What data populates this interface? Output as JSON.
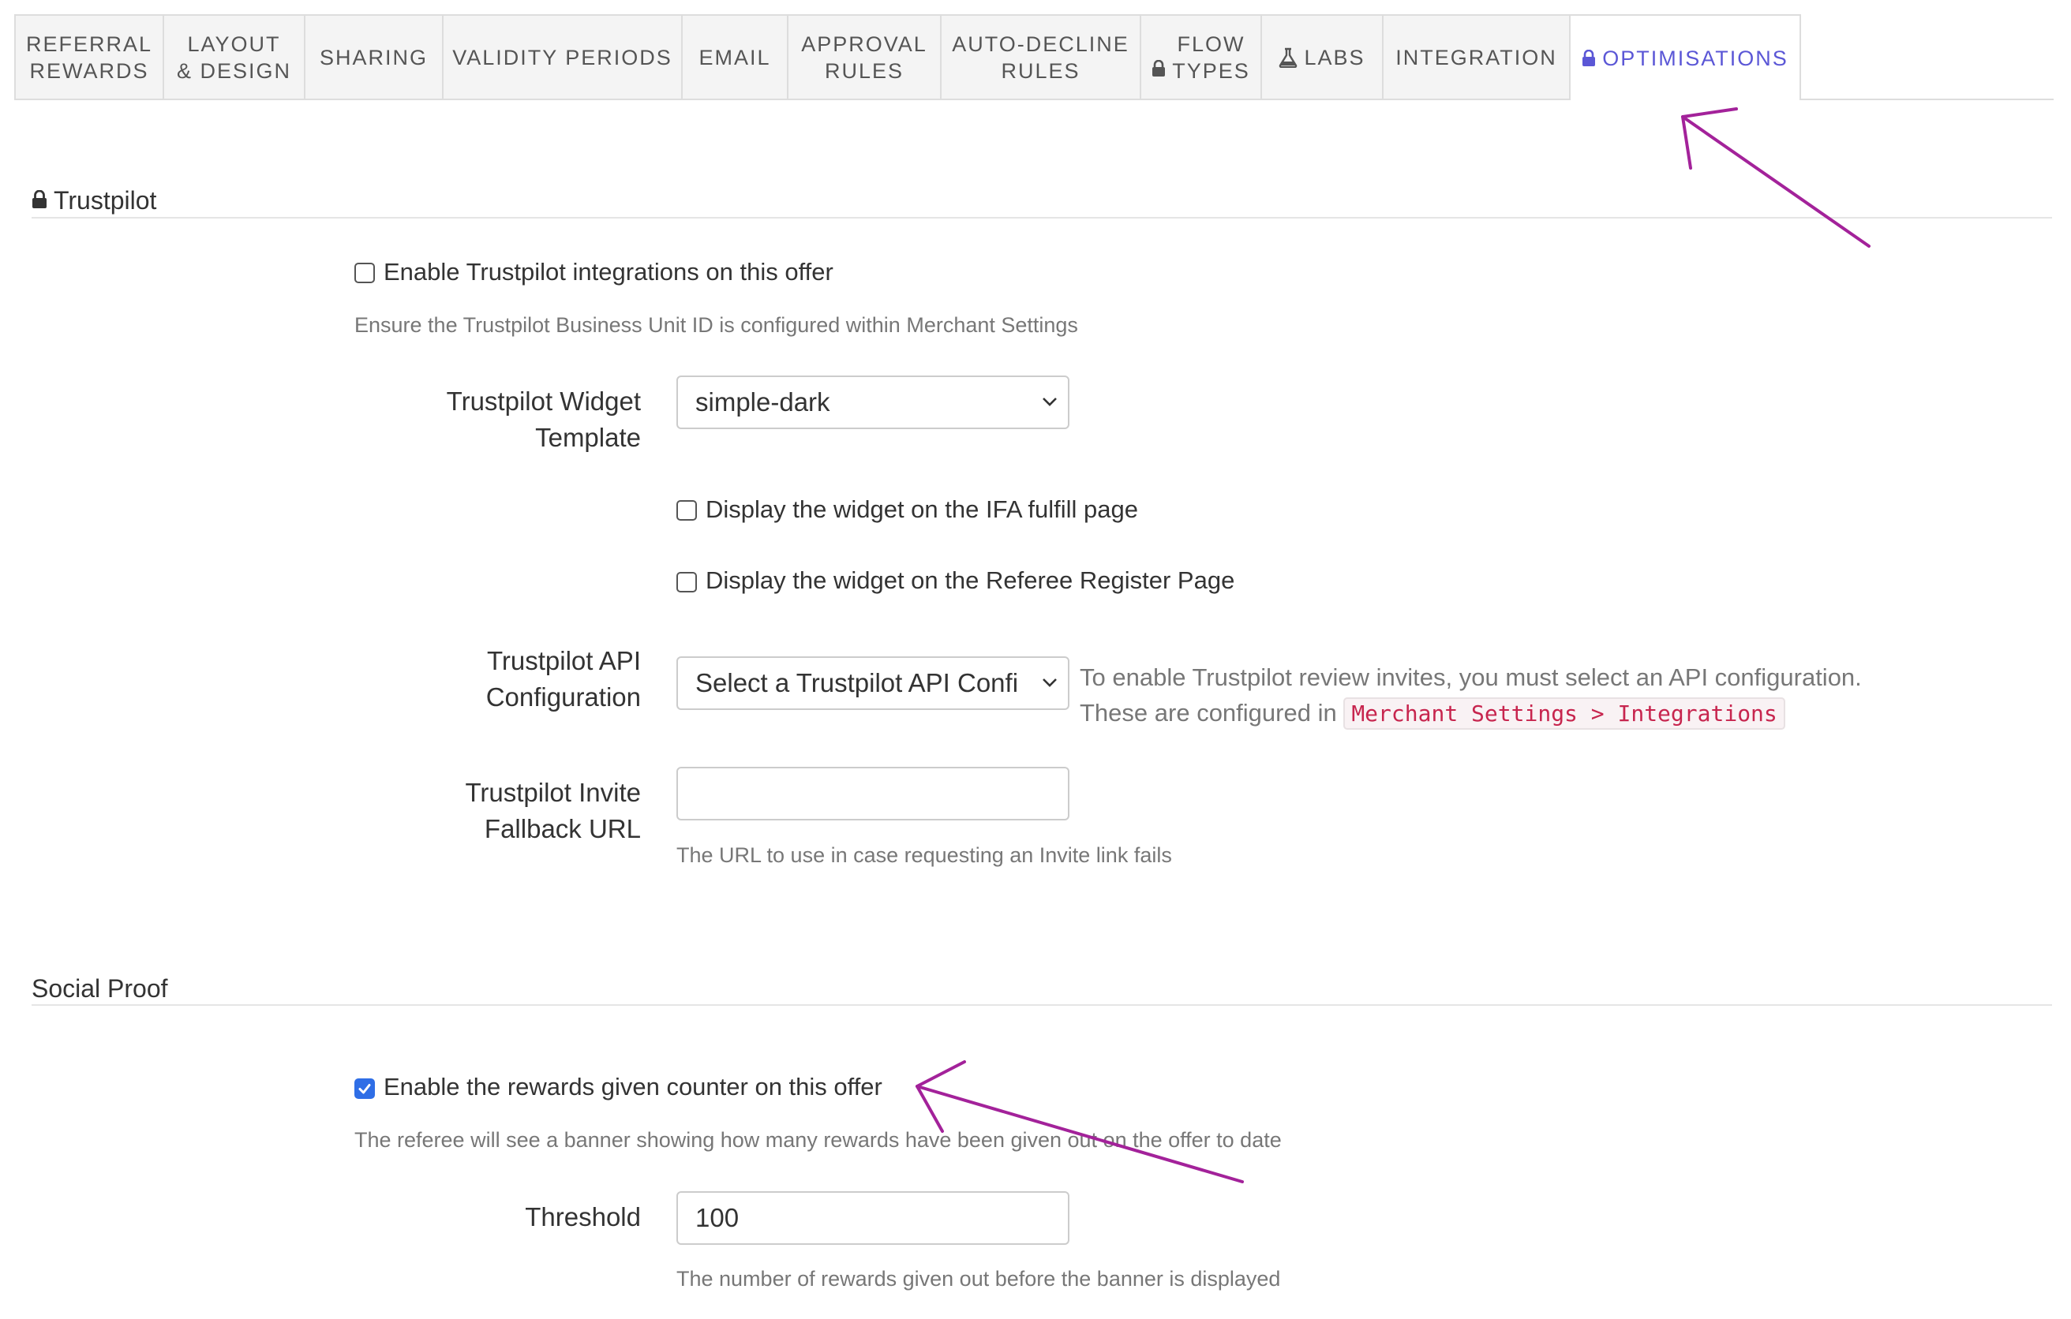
{
  "tabs": [
    {
      "label": "REFERRAL\nREWARDS",
      "icon": null,
      "active": false
    },
    {
      "label": "LAYOUT\n& DESIGN",
      "icon": null,
      "active": false
    },
    {
      "label": "SHARING",
      "icon": null,
      "active": false
    },
    {
      "label": "VALIDITY PERIODS",
      "icon": null,
      "active": false
    },
    {
      "label": "EMAIL",
      "icon": null,
      "active": false
    },
    {
      "label": "APPROVAL\nRULES",
      "icon": null,
      "active": false
    },
    {
      "label": "AUTO-DECLINE\nRULES",
      "icon": null,
      "active": false
    },
    {
      "label": "FLOW\nTYPES",
      "icon": "lock-icon",
      "active": false
    },
    {
      "label": "LABS",
      "icon": "flask-icon",
      "active": false
    },
    {
      "label": "INTEGRATION",
      "icon": null,
      "active": false
    },
    {
      "label": "OPTIMISATIONS",
      "icon": "lock-icon",
      "active": true
    }
  ],
  "colors": {
    "active_tab": "#5b57d6",
    "checkbox_checked": "#2f6ee6",
    "annotation_arrow": "#a3229a",
    "code_text": "#c7254e"
  },
  "trustpilot": {
    "title": "Trustpilot",
    "title_icon": "lock-icon",
    "enable": {
      "label": "Enable Trustpilot integrations on this offer",
      "checked": false
    },
    "enable_help": "Ensure the Trustpilot Business Unit ID is configured within Merchant Settings",
    "widget_template": {
      "label": "Trustpilot Widget\nTemplate",
      "value": "simple-dark"
    },
    "display_ifa": {
      "label": "Display the widget on the IFA fulfill page",
      "checked": false
    },
    "display_referee": {
      "label": "Display the widget on the Referee Register Page",
      "checked": false
    },
    "api_config": {
      "label": "Trustpilot API\nConfiguration",
      "value": "Select a Trustpilot API Confi",
      "note_line1": "To enable Trustpilot review invites, you must select an API configuration.",
      "note_line2": "These are configured in",
      "note_code": "Merchant Settings > Integrations"
    },
    "fallback_url": {
      "label": "Trustpilot Invite\nFallback URL",
      "value": "",
      "help": "The URL to use in case requesting an Invite link fails"
    }
  },
  "social_proof": {
    "title": "Social Proof",
    "enable": {
      "label": "Enable the rewards given counter on this offer",
      "checked": true
    },
    "enable_help": "The referee will see a banner showing how many rewards have been given out on the offer to date",
    "threshold": {
      "label": "Threshold",
      "value": "100",
      "help": "The number of rewards given out before the banner is displayed"
    }
  }
}
